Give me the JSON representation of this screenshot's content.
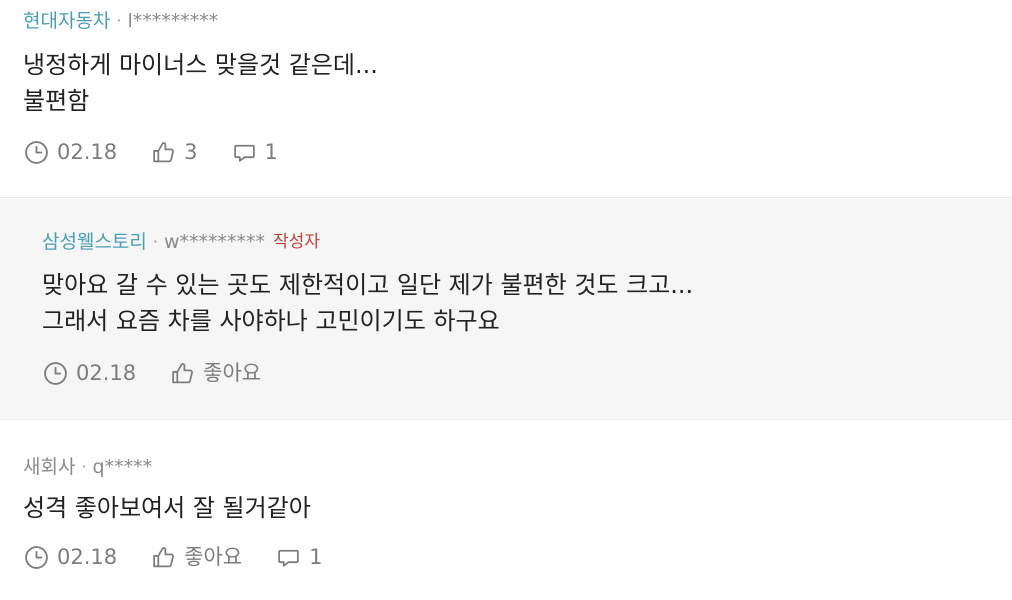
{
  "comments": [
    {
      "company": "현대자동차",
      "user": "l*********",
      "lines": [
        "냉정하게 마이너스 맞을것 같은데...",
        "불편함"
      ],
      "date": "02.18",
      "likes": "3",
      "replies": "1"
    },
    {
      "company": "삼성웰스토리",
      "user": "w*********",
      "author_badge": "작성자",
      "lines": [
        "맞아요 갈 수 있는 곳도 제한적이고 일단 제가 불편한 것도 크고...",
        "그래서 요즘 차를 사야하나 고민이기도 하구요"
      ],
      "date": "02.18",
      "likes": "좋아요"
    },
    {
      "company": "새회사",
      "user": "q*****",
      "lines": [
        "성격 좋아보여서 잘 될거같아"
      ],
      "date": "02.18",
      "likes": "좋아요",
      "replies": "1"
    }
  ],
  "separator": "·",
  "icons": {
    "time": "clock-icon",
    "like": "thumbs-up-icon",
    "reply": "speech-bubble-icon"
  },
  "colors": {
    "company": "#4a9fb5",
    "author_badge": "#c8403a",
    "meta_gray": "#7d7d7d",
    "reply_bg": "#f6f6f6"
  }
}
